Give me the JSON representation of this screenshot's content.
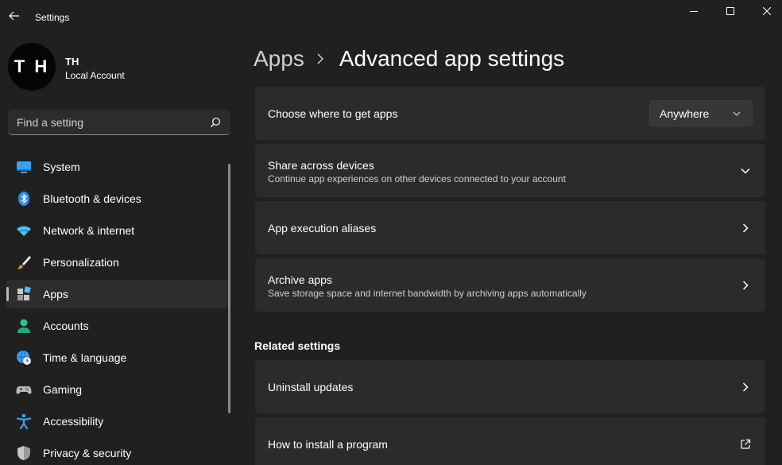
{
  "window": {
    "title": "Settings"
  },
  "profile": {
    "initials": "T H",
    "name": "TH",
    "account_type": "Local Account"
  },
  "search": {
    "placeholder": "Find a setting"
  },
  "sidebar": {
    "items": [
      {
        "label": "System",
        "icon": "system-icon",
        "selected": false
      },
      {
        "label": "Bluetooth & devices",
        "icon": "bluetooth-icon",
        "selected": false
      },
      {
        "label": "Network & internet",
        "icon": "wifi-icon",
        "selected": false
      },
      {
        "label": "Personalization",
        "icon": "paintbrush-icon",
        "selected": false
      },
      {
        "label": "Apps",
        "icon": "apps-icon",
        "selected": true
      },
      {
        "label": "Accounts",
        "icon": "person-icon",
        "selected": false
      },
      {
        "label": "Time & language",
        "icon": "globe-clock-icon",
        "selected": false
      },
      {
        "label": "Gaming",
        "icon": "gamepad-icon",
        "selected": false
      },
      {
        "label": "Accessibility",
        "icon": "accessibility-icon",
        "selected": false
      },
      {
        "label": "Privacy & security",
        "icon": "shield-icon",
        "selected": false
      }
    ]
  },
  "breadcrumb": {
    "parent": "Apps",
    "current": "Advanced app settings"
  },
  "settings": {
    "choose_where": {
      "title": "Choose where to get apps",
      "dropdown_value": "Anywhere"
    },
    "share_across": {
      "title": "Share across devices",
      "description": "Continue app experiences on other devices connected to your account"
    },
    "execution_aliases": {
      "title": "App execution aliases"
    },
    "archive_apps": {
      "title": "Archive apps",
      "description": "Save storage space and internet bandwidth by archiving apps automatically"
    }
  },
  "related": {
    "heading": "Related settings",
    "uninstall_updates": "Uninstall updates",
    "install_program": "How to install a program"
  },
  "colors": {
    "background": "#202020",
    "card": "#2b2b2b",
    "accent": "#4cc2ff"
  }
}
